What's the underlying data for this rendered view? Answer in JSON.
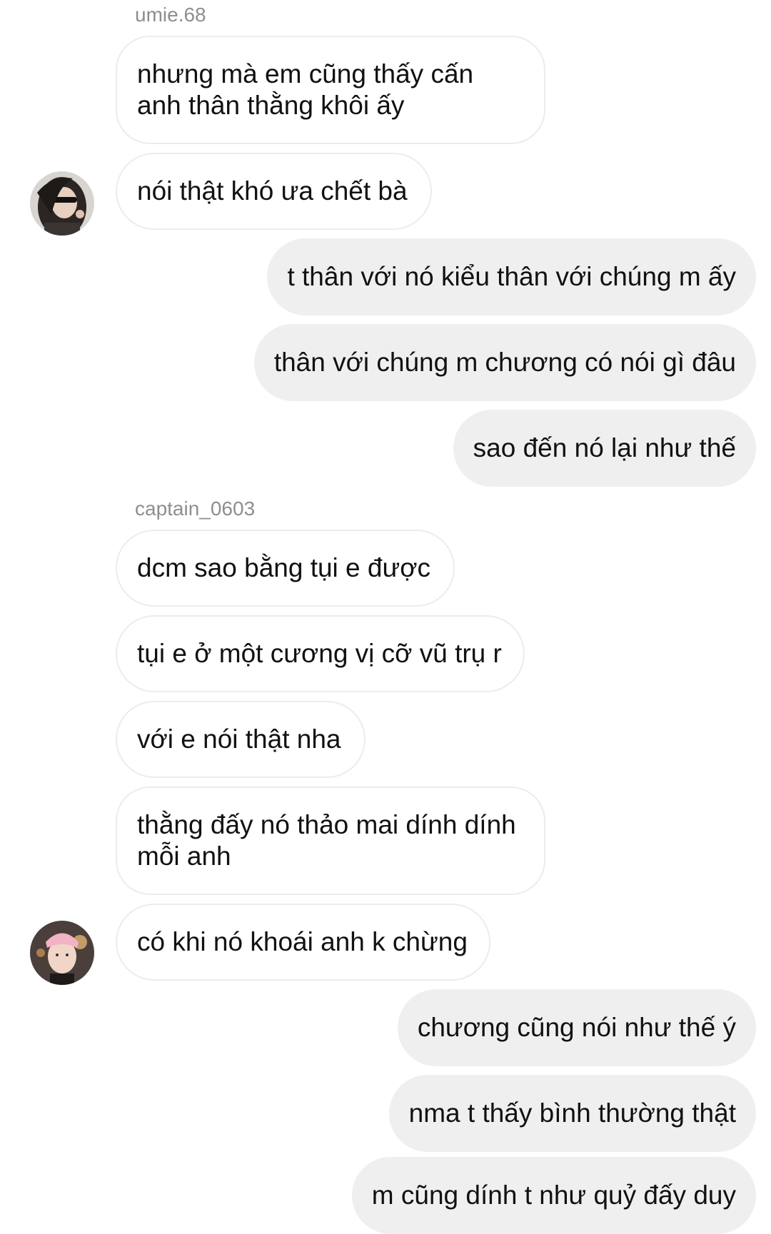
{
  "groups": [
    {
      "sender": "umie.68",
      "messages": [
        "nhưng mà em cũng thấy cấn\nanh thân thằng khôi ấy",
        "nói thật khó ưa chết bà"
      ],
      "avatar_icon": "profile-photo-girl-sunglasses"
    },
    {
      "sender": "me",
      "messages": [
        "t thân với nó kiểu thân với chúng m ấy",
        "thân với chúng m chương có nói gì đâu",
        "sao đến nó lại như thế"
      ]
    },
    {
      "sender": "captain_0603",
      "messages": [
        "dcm sao bằng tụi e được",
        "tụi e ở một cương vị cỡ vũ trụ r",
        "với e nói thật nha",
        "thằng đấy nó thảo mai dính dính\nmỗi anh",
        "có khi nó khoái anh k chừng"
      ],
      "avatar_icon": "profile-photo-boy-pink-beanie"
    },
    {
      "sender": "me",
      "messages": [
        "chương cũng nói như thế ý",
        "nma t thấy bình thường thật",
        "m cũng dính t như quỷ đấy duy"
      ]
    }
  ],
  "colors": {
    "incoming_bg": "#ffffff",
    "incoming_border": "#ececec",
    "outgoing_bg": "#efefef",
    "sender_name": "#8e8e8e",
    "text": "#111111"
  }
}
